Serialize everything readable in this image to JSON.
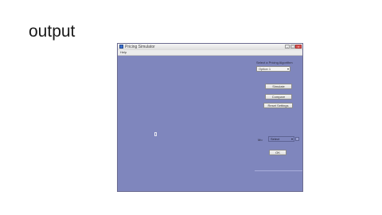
{
  "slide": {
    "title": "output"
  },
  "window": {
    "title": "Pricing Simulator",
    "menu": [
      "Help"
    ],
    "label": "Select a Pricing Algorithm",
    "select_value": "Option 1",
    "buttons": {
      "b1": "Simulate",
      "b2": "Compare",
      "b3": "Reset Settings",
      "ok": "OK"
    },
    "field_label": "Mo",
    "field_value": "Select"
  }
}
